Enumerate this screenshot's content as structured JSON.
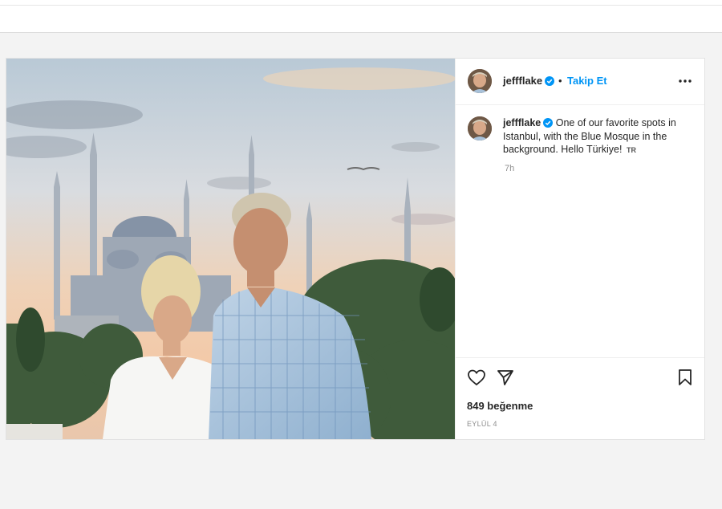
{
  "post": {
    "username": "jeffflake",
    "follow_label": "Takip Et",
    "separator": "•",
    "caption": "One of our favorite spots in Istanbul, with the Blue Mosque in the background. Hello Türkiye!",
    "caption_tag": "TR",
    "time": "7h",
    "likes": "849 beğenme",
    "date": "EYLÜL 4"
  },
  "icons": {
    "like": "heart-icon",
    "share": "paper-plane-icon",
    "save": "bookmark-icon",
    "more": "more-horizontal-icon",
    "verified": "verified-badge-icon"
  },
  "colors": {
    "accent": "#0095f6",
    "text": "#262626",
    "muted": "#8e8e8e"
  }
}
